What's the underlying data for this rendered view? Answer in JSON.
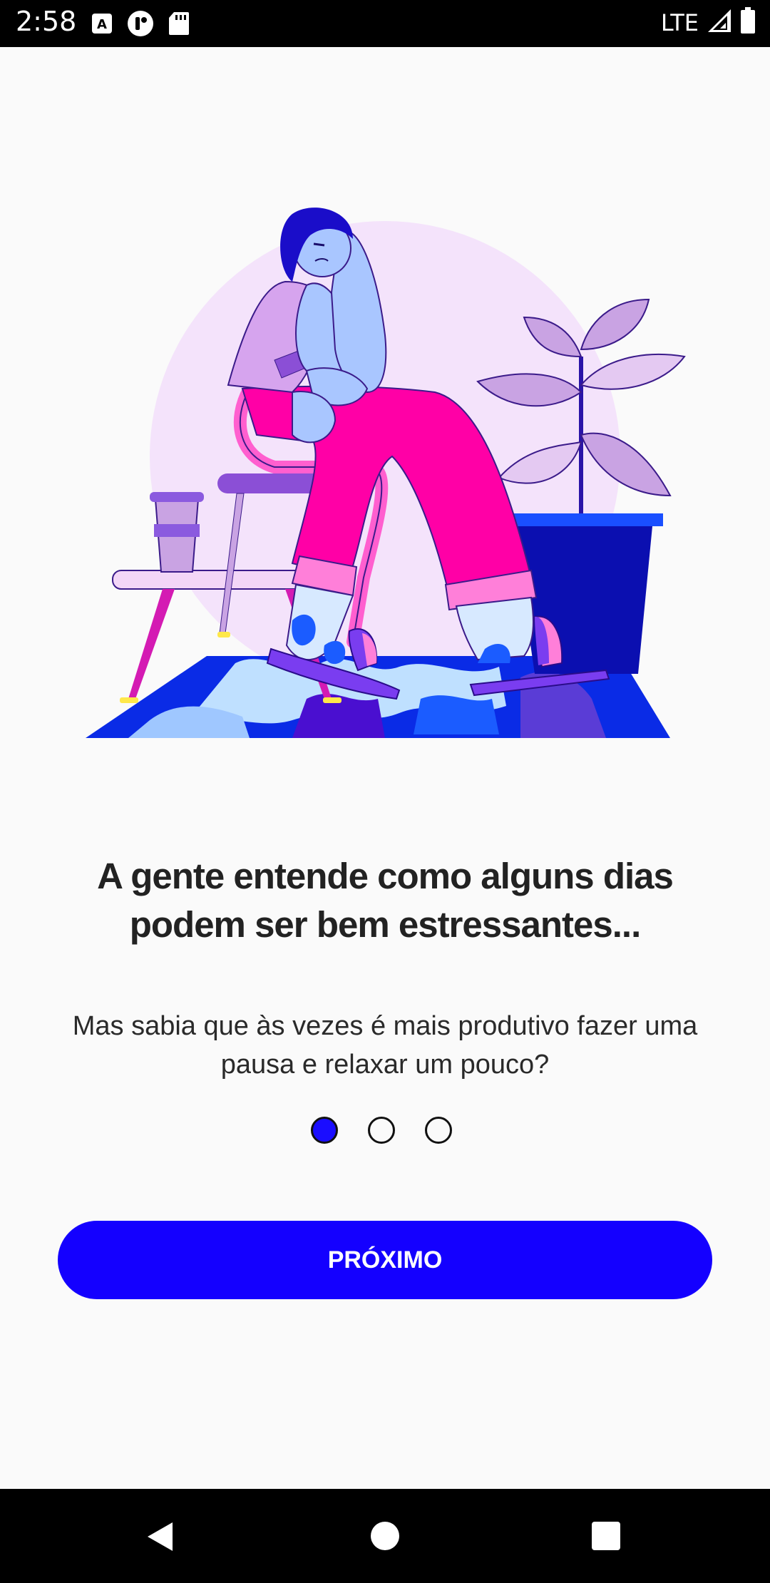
{
  "status_bar": {
    "time": "2:58",
    "network": "LTE",
    "left_icons": [
      "a-icon",
      "app-icon",
      "sd-card-icon"
    ],
    "right_icons": [
      "signal-icon",
      "battery-icon"
    ]
  },
  "onboarding": {
    "illustration": "stressed-woman-illustration",
    "headline": "A gente entende como alguns dias podem ser bem estressantes...",
    "body": "Mas sabia que às vezes é mais produtivo fazer uma pausa e relaxar um pouco?",
    "pager": {
      "current": 1,
      "total": 3
    },
    "next_label": "PRÓXIMO"
  },
  "colors": {
    "accent": "#1400ff",
    "background": "#fafafa",
    "text": "#222222"
  },
  "nav_bar": {
    "back": "back-icon",
    "home": "home-icon",
    "recents": "recents-icon"
  }
}
